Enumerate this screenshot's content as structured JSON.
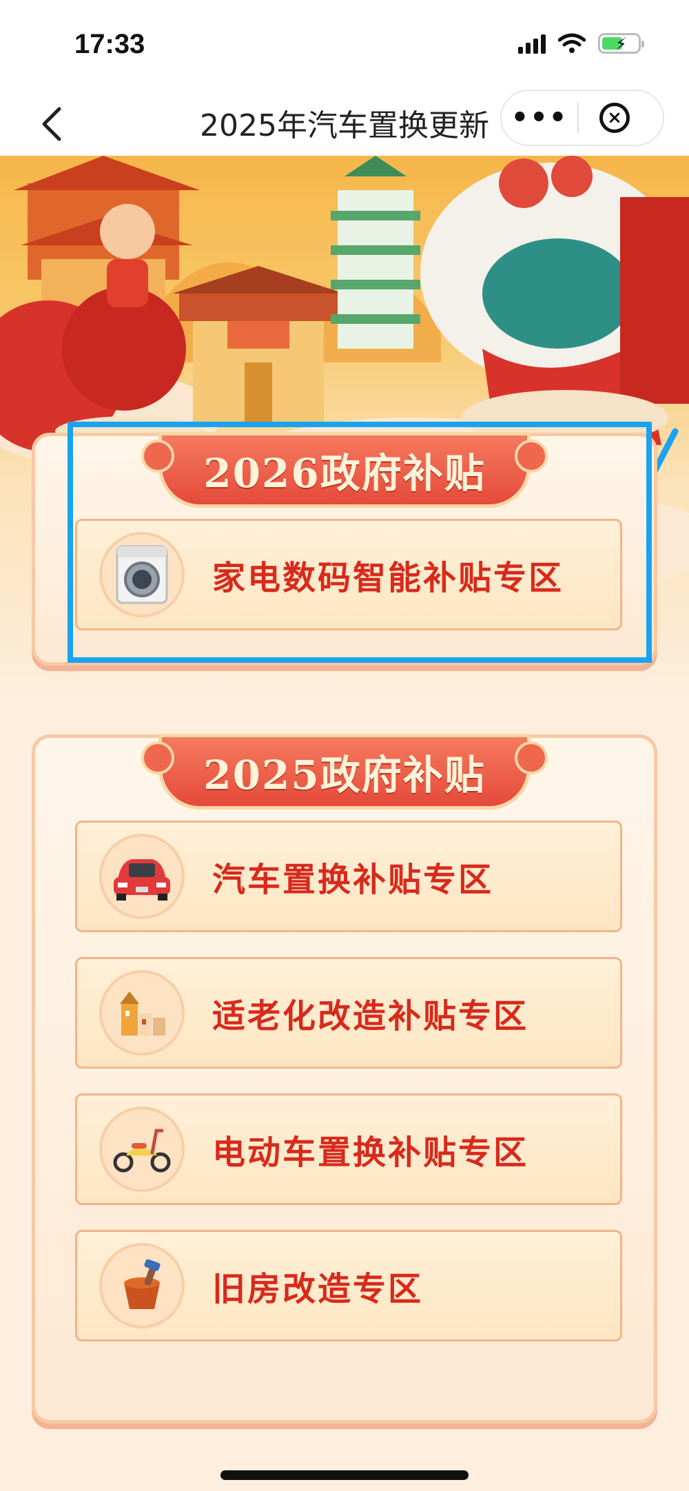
{
  "status_bar": {
    "time": "17:33",
    "battery_level": 0.58,
    "icons": [
      "signal-icon",
      "wifi-icon",
      "battery-charging-icon"
    ]
  },
  "nav": {
    "title": "2025年汽车置换更新",
    "back_icon": "chevron-left-icon",
    "more_icon": "more-dots-icon",
    "close_icon": "close-circle-icon"
  },
  "sections": [
    {
      "title": "2026政府补贴",
      "items": [
        {
          "label": "家电数码智能补贴专区",
          "icon": "washing-machine-icon"
        }
      ]
    },
    {
      "title": "2025政府补贴",
      "items": [
        {
          "label": "汽车置换补贴专区",
          "icon": "car-icon"
        },
        {
          "label": "适老化改造补贴专区",
          "icon": "houses-icon"
        },
        {
          "label": "电动车置换补贴专区",
          "icon": "scooter-icon"
        },
        {
          "label": "旧房改造专区",
          "icon": "paint-bucket-icon"
        }
      ]
    }
  ],
  "colors": {
    "accent_red": "#d82a1c",
    "highlight_blue": "#1aa3f0",
    "panel_bg": "#fff6ea"
  }
}
